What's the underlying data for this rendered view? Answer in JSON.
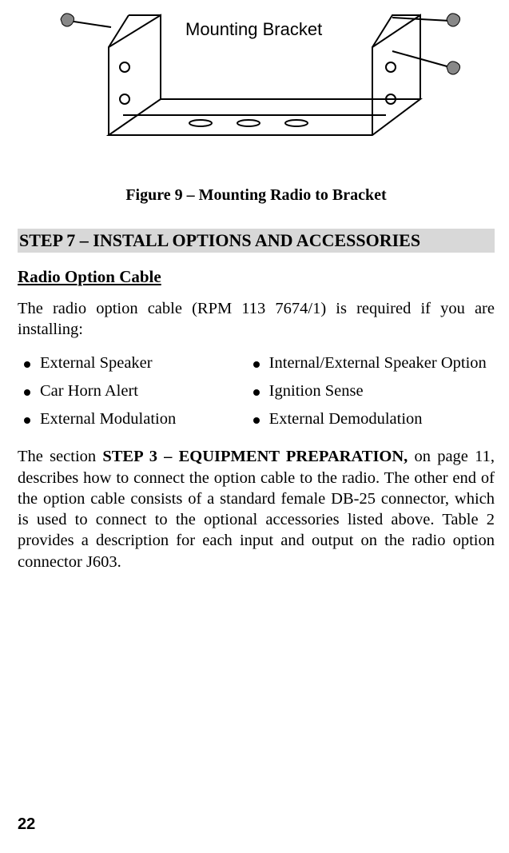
{
  "figure": {
    "label": "Mounting Bracket",
    "caption": "Figure 9 – Mounting Radio to Bracket"
  },
  "step_heading": "STEP 7 – INSTALL OPTIONS AND ACCESSORIES",
  "sub_heading": "Radio Option Cable",
  "intro": "The radio option cable (RPM 113 7674/1) is required if you are installing:",
  "bullets": {
    "left": [
      "External Speaker",
      "Car Horn Alert",
      "External Modulation"
    ],
    "right": [
      "Internal/External Speaker Option",
      "Ignition Sense",
      "External Demodulation"
    ]
  },
  "body": {
    "pre": "The section ",
    "bold": "STEP 3 – EQUIPMENT PREPARATION,",
    "post": " on page 11, describes how to connect the option cable to the radio.  The other end of the option cable consists of a standard female DB-25 connector, which is used to connect to the optional accessories listed above.  Table 2 provides a description for each input and output on the radio option connector J603."
  },
  "page_number": "22"
}
